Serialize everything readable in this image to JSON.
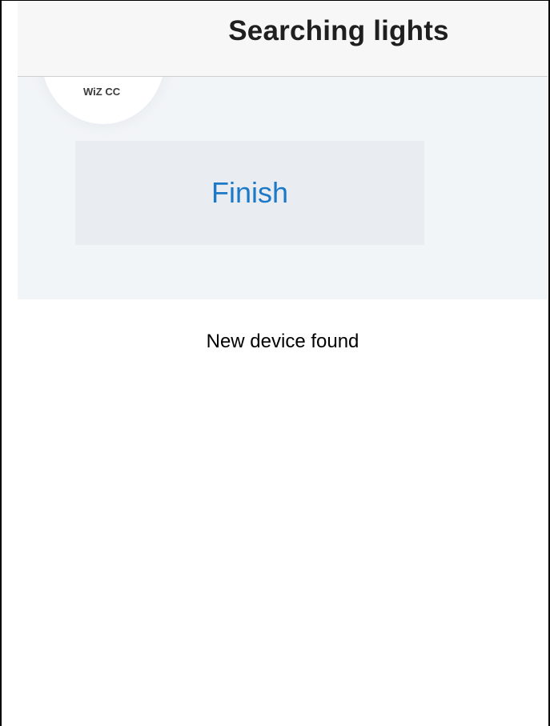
{
  "nav": {
    "title": "Searching lights"
  },
  "device": {
    "name": "WiZ CC"
  },
  "actions": {
    "finish_label": "Finish"
  },
  "caption": {
    "text": "New device found"
  },
  "colors": {
    "accent": "#1b79c8",
    "panel_background": "#f2f5f8",
    "button_background": "#e9edf2"
  }
}
